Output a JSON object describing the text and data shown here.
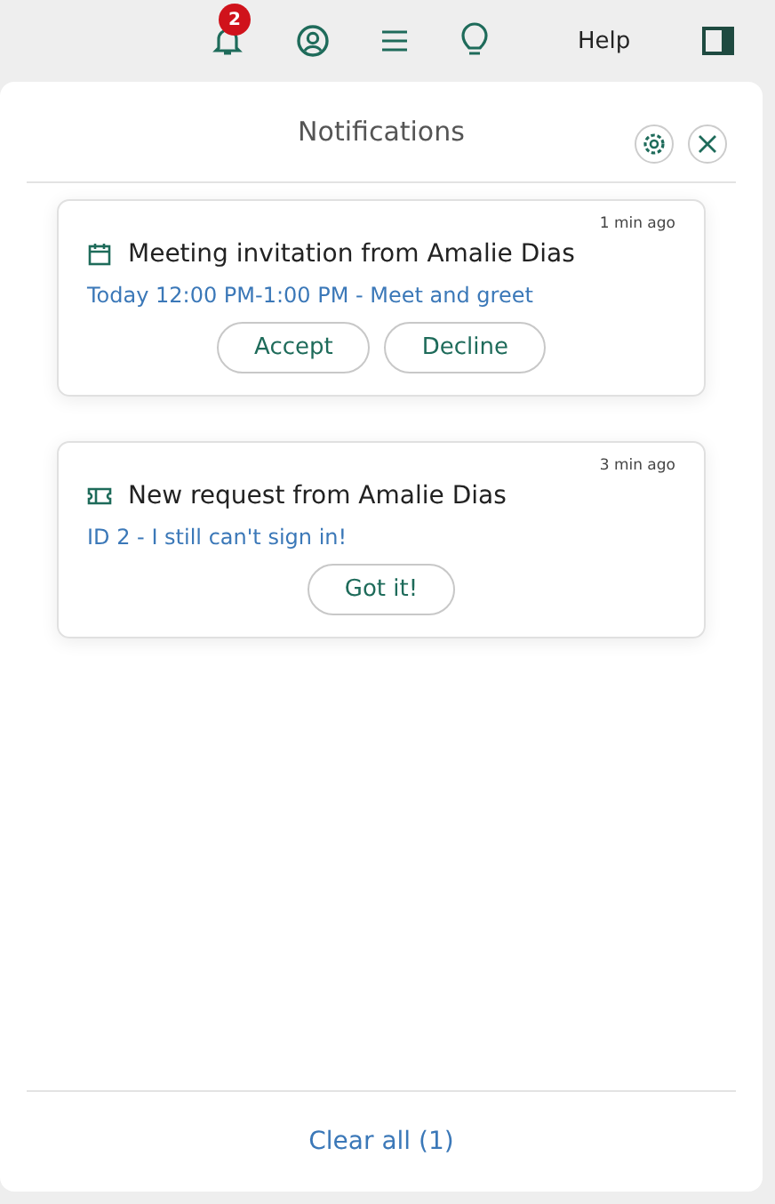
{
  "top_bar": {
    "notification_badge": "2",
    "help": "Help"
  },
  "panel": {
    "title": "Notifications",
    "notifications": [
      {
        "kind": "meeting",
        "time": "1 min ago",
        "title": "Meeting invitation from Amalie Dias",
        "detail": "Today 12:00 PM-1:00 PM - Meet and greet",
        "buttons": [
          "Accept",
          "Decline"
        ]
      },
      {
        "kind": "request",
        "time": "3 min ago",
        "title": "New request from Amalie Dias",
        "detail": "ID 2 - I still can't sign in!",
        "buttons": [
          "Got it!"
        ]
      }
    ],
    "footer": "Clear all (1)"
  }
}
